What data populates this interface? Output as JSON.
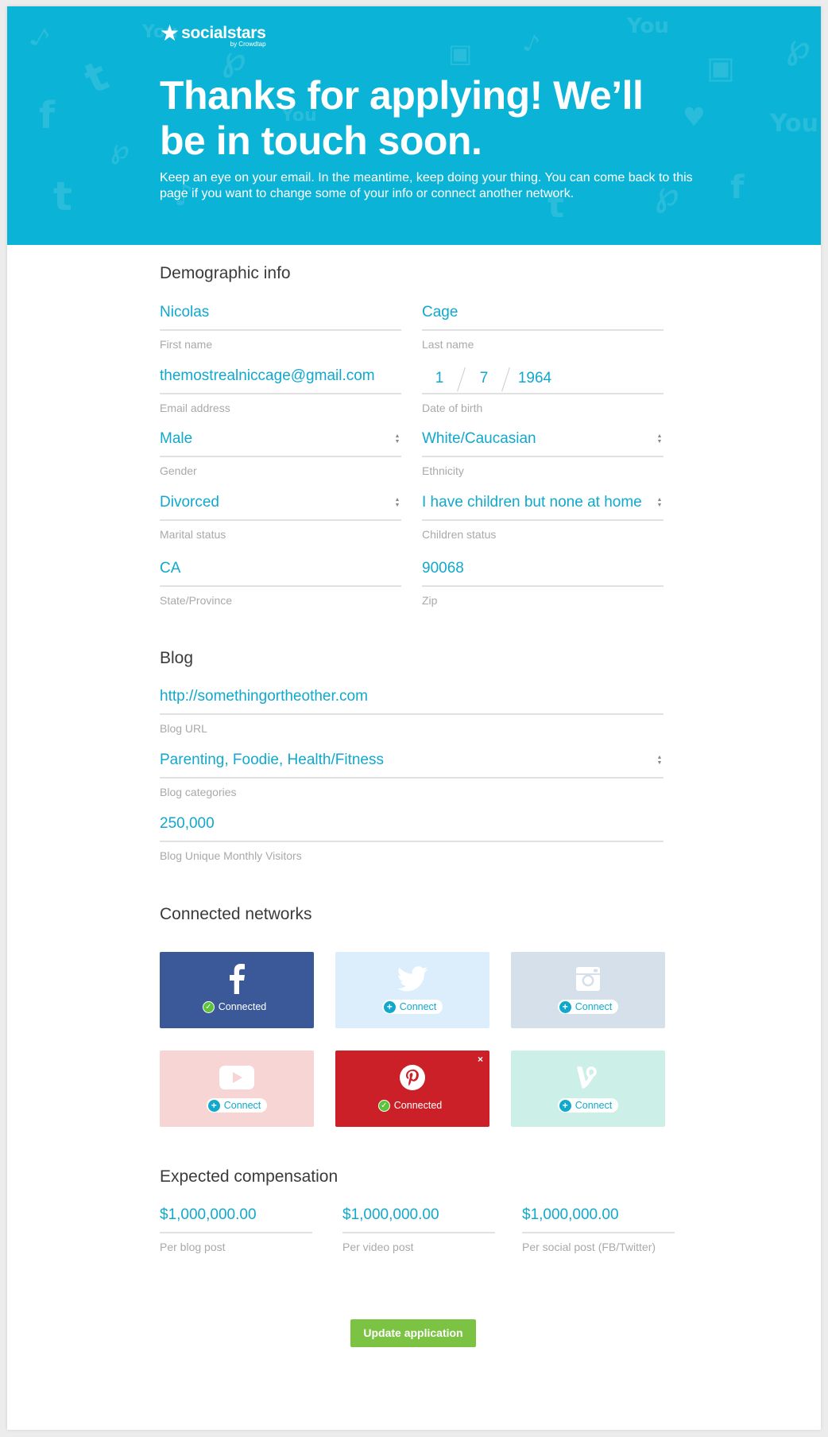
{
  "brand": {
    "name": "socialstars",
    "tagline": "by Crowdtap"
  },
  "hero": {
    "title": "Thanks for applying! We’ll be in touch soon.",
    "text": "Keep an eye on your email. In the meantime, keep doing your thing. You can come back to this page if you want to change some of your info or connect another network."
  },
  "demographic": {
    "title": "Demographic info",
    "first_name": {
      "value": "Nicolas",
      "label": "First name"
    },
    "last_name": {
      "value": "Cage",
      "label": "Last name"
    },
    "email": {
      "value": "themostrealniccage@gmail.com",
      "label": "Email address"
    },
    "dob": {
      "month": "1",
      "day": "7",
      "year": "1964",
      "label": "Date of birth"
    },
    "gender": {
      "value": "Male",
      "label": "Gender"
    },
    "ethnicity": {
      "value": "White/Caucasian",
      "label": "Ethnicity"
    },
    "marital": {
      "value": "Divorced",
      "label": "Marital status"
    },
    "children": {
      "value": "I have children but none at home",
      "label": "Children status"
    },
    "state": {
      "value": "CA",
      "label": "State/Province"
    },
    "zip": {
      "value": "90068",
      "label": "Zip"
    }
  },
  "blog": {
    "title": "Blog",
    "url": {
      "value": "http://somethingortheother.com",
      "label": "Blog URL"
    },
    "categories": {
      "value": "Parenting, Foodie, Health/Fitness",
      "label": "Blog categories"
    },
    "visitors": {
      "value": "250,000",
      "label": "Blog Unique Monthly Visitors"
    }
  },
  "networks": {
    "title": "Connected networks",
    "items": [
      {
        "name": "Facebook",
        "icon": "facebook-icon",
        "status": "Connected",
        "color": "#3b5998"
      },
      {
        "name": "Twitter",
        "icon": "twitter-icon",
        "status": "Connect",
        "color": "#dcedfb"
      },
      {
        "name": "Instagram",
        "icon": "instagram-icon",
        "status": "Connect",
        "color": "#d6e0ea"
      },
      {
        "name": "YouTube",
        "icon": "youtube-icon",
        "status": "Connect",
        "color": "#f8d5d5"
      },
      {
        "name": "Pinterest",
        "icon": "pinterest-icon",
        "status": "Connected",
        "color": "#cb2027"
      },
      {
        "name": "Vine",
        "icon": "vine-icon",
        "status": "Connect",
        "color": "#ccf0e7"
      }
    ]
  },
  "compensation": {
    "title": "Expected compensation",
    "blog_post": {
      "value": "$1,000,000.00",
      "label": "Per blog post"
    },
    "video_post": {
      "value": "$1,000,000.00",
      "label": "Per video post"
    },
    "social_post": {
      "value": "$1,000,000.00",
      "label": "Per social post (FB/Twitter)"
    }
  },
  "actions": {
    "update_label": "Update application"
  },
  "colors": {
    "accent": "#10a9cc",
    "hero_bg": "#0bb4d6",
    "button": "#7cc243"
  }
}
